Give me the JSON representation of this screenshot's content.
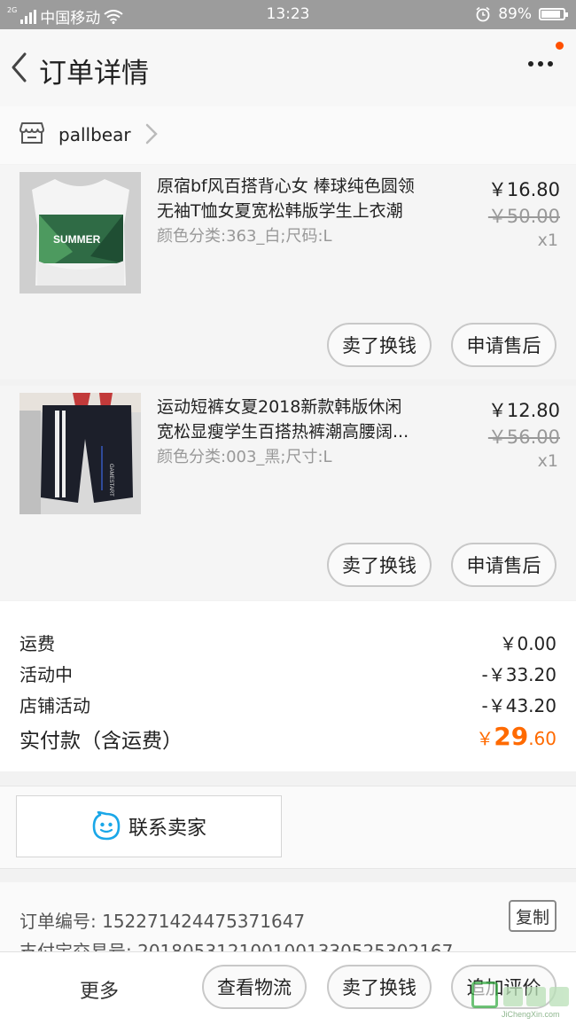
{
  "status_bar": {
    "carrier": "中国移动",
    "network_tag": "2G",
    "time": "13:23",
    "battery": "89%",
    "battery_level": 0.89
  },
  "header": {
    "title": "订单详情"
  },
  "shop": {
    "name": "pallbear"
  },
  "products": [
    {
      "title_line1": "原宿bf风百搭背心女 棒球纯色圆领",
      "title_line2": "无袖T恤女夏宽松韩版学生上衣潮",
      "sku": "颜色分类:363_白;尺码:L",
      "price": "￥16.80",
      "original_price": "￥50.00",
      "quantity": "x1",
      "thumb_text": "SUMMER",
      "btn_resell": "卖了换钱",
      "btn_after_sale": "申请售后"
    },
    {
      "title_line1": "运动短裤女夏2018新款韩版休闲",
      "title_line2": "宽松显瘦学生百搭热裤潮高腰阔...",
      "sku": "颜色分类:003_黑;尺寸:L",
      "price": "￥12.80",
      "original_price": "￥56.00",
      "quantity": "x1",
      "thumb_text": "GAMESTART",
      "btn_resell": "卖了换钱",
      "btn_after_sale": "申请售后"
    }
  ],
  "summary": {
    "shipping_label": "运费",
    "shipping_value": "￥0.00",
    "promo_label": "活动中",
    "promo_value": "-￥33.20",
    "shop_promo_label": "店铺活动",
    "shop_promo_value": "-￥43.20",
    "total_label": "实付款（含运费）",
    "total_symbol": "￥",
    "total_major": "29",
    "total_minor": ".60"
  },
  "contact": {
    "label": "联系卖家"
  },
  "order_info": {
    "order_no": "订单编号: 152271424475371647",
    "copy_label": "复制",
    "pay_no": "支付宝交易号: 2018053121001001330525302167"
  },
  "bottom_bar": {
    "more": "更多",
    "logistics": "查看物流",
    "resell": "卖了换钱",
    "add_review": "追加评价"
  },
  "watermark": {
    "text": "JiChengXin.com"
  },
  "colors": {
    "accent": "#ff6a00",
    "notify_dot": "#ff5000",
    "status_bar": "#9c9c9c",
    "contact_icon": "#1aa7e8"
  }
}
